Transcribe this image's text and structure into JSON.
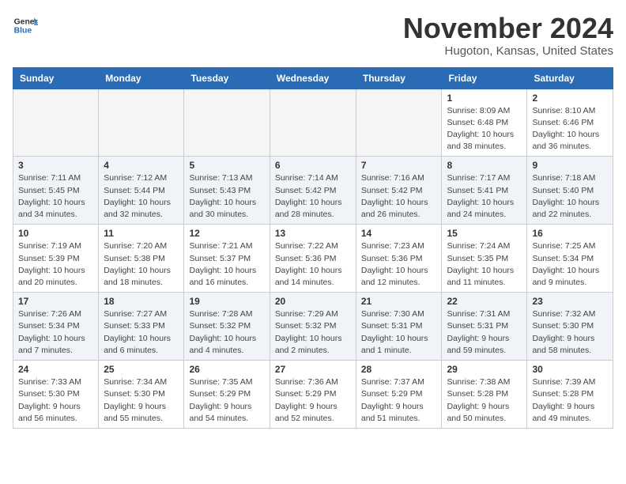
{
  "header": {
    "logo_general": "General",
    "logo_blue": "Blue",
    "month_title": "November 2024",
    "location": "Hugoton, Kansas, United States"
  },
  "weekdays": [
    "Sunday",
    "Monday",
    "Tuesday",
    "Wednesday",
    "Thursday",
    "Friday",
    "Saturday"
  ],
  "weeks": [
    [
      {
        "day": "",
        "info": ""
      },
      {
        "day": "",
        "info": ""
      },
      {
        "day": "",
        "info": ""
      },
      {
        "day": "",
        "info": ""
      },
      {
        "day": "",
        "info": ""
      },
      {
        "day": "1",
        "info": "Sunrise: 8:09 AM\nSunset: 6:48 PM\nDaylight: 10 hours\nand 38 minutes."
      },
      {
        "day": "2",
        "info": "Sunrise: 8:10 AM\nSunset: 6:46 PM\nDaylight: 10 hours\nand 36 minutes."
      }
    ],
    [
      {
        "day": "3",
        "info": "Sunrise: 7:11 AM\nSunset: 5:45 PM\nDaylight: 10 hours\nand 34 minutes."
      },
      {
        "day": "4",
        "info": "Sunrise: 7:12 AM\nSunset: 5:44 PM\nDaylight: 10 hours\nand 32 minutes."
      },
      {
        "day": "5",
        "info": "Sunrise: 7:13 AM\nSunset: 5:43 PM\nDaylight: 10 hours\nand 30 minutes."
      },
      {
        "day": "6",
        "info": "Sunrise: 7:14 AM\nSunset: 5:42 PM\nDaylight: 10 hours\nand 28 minutes."
      },
      {
        "day": "7",
        "info": "Sunrise: 7:16 AM\nSunset: 5:42 PM\nDaylight: 10 hours\nand 26 minutes."
      },
      {
        "day": "8",
        "info": "Sunrise: 7:17 AM\nSunset: 5:41 PM\nDaylight: 10 hours\nand 24 minutes."
      },
      {
        "day": "9",
        "info": "Sunrise: 7:18 AM\nSunset: 5:40 PM\nDaylight: 10 hours\nand 22 minutes."
      }
    ],
    [
      {
        "day": "10",
        "info": "Sunrise: 7:19 AM\nSunset: 5:39 PM\nDaylight: 10 hours\nand 20 minutes."
      },
      {
        "day": "11",
        "info": "Sunrise: 7:20 AM\nSunset: 5:38 PM\nDaylight: 10 hours\nand 18 minutes."
      },
      {
        "day": "12",
        "info": "Sunrise: 7:21 AM\nSunset: 5:37 PM\nDaylight: 10 hours\nand 16 minutes."
      },
      {
        "day": "13",
        "info": "Sunrise: 7:22 AM\nSunset: 5:36 PM\nDaylight: 10 hours\nand 14 minutes."
      },
      {
        "day": "14",
        "info": "Sunrise: 7:23 AM\nSunset: 5:36 PM\nDaylight: 10 hours\nand 12 minutes."
      },
      {
        "day": "15",
        "info": "Sunrise: 7:24 AM\nSunset: 5:35 PM\nDaylight: 10 hours\nand 11 minutes."
      },
      {
        "day": "16",
        "info": "Sunrise: 7:25 AM\nSunset: 5:34 PM\nDaylight: 10 hours\nand 9 minutes."
      }
    ],
    [
      {
        "day": "17",
        "info": "Sunrise: 7:26 AM\nSunset: 5:34 PM\nDaylight: 10 hours\nand 7 minutes."
      },
      {
        "day": "18",
        "info": "Sunrise: 7:27 AM\nSunset: 5:33 PM\nDaylight: 10 hours\nand 6 minutes."
      },
      {
        "day": "19",
        "info": "Sunrise: 7:28 AM\nSunset: 5:32 PM\nDaylight: 10 hours\nand 4 minutes."
      },
      {
        "day": "20",
        "info": "Sunrise: 7:29 AM\nSunset: 5:32 PM\nDaylight: 10 hours\nand 2 minutes."
      },
      {
        "day": "21",
        "info": "Sunrise: 7:30 AM\nSunset: 5:31 PM\nDaylight: 10 hours\nand 1 minute."
      },
      {
        "day": "22",
        "info": "Sunrise: 7:31 AM\nSunset: 5:31 PM\nDaylight: 9 hours\nand 59 minutes."
      },
      {
        "day": "23",
        "info": "Sunrise: 7:32 AM\nSunset: 5:30 PM\nDaylight: 9 hours\nand 58 minutes."
      }
    ],
    [
      {
        "day": "24",
        "info": "Sunrise: 7:33 AM\nSunset: 5:30 PM\nDaylight: 9 hours\nand 56 minutes."
      },
      {
        "day": "25",
        "info": "Sunrise: 7:34 AM\nSunset: 5:30 PM\nDaylight: 9 hours\nand 55 minutes."
      },
      {
        "day": "26",
        "info": "Sunrise: 7:35 AM\nSunset: 5:29 PM\nDaylight: 9 hours\nand 54 minutes."
      },
      {
        "day": "27",
        "info": "Sunrise: 7:36 AM\nSunset: 5:29 PM\nDaylight: 9 hours\nand 52 minutes."
      },
      {
        "day": "28",
        "info": "Sunrise: 7:37 AM\nSunset: 5:29 PM\nDaylight: 9 hours\nand 51 minutes."
      },
      {
        "day": "29",
        "info": "Sunrise: 7:38 AM\nSunset: 5:28 PM\nDaylight: 9 hours\nand 50 minutes."
      },
      {
        "day": "30",
        "info": "Sunrise: 7:39 AM\nSunset: 5:28 PM\nDaylight: 9 hours\nand 49 minutes."
      }
    ]
  ]
}
